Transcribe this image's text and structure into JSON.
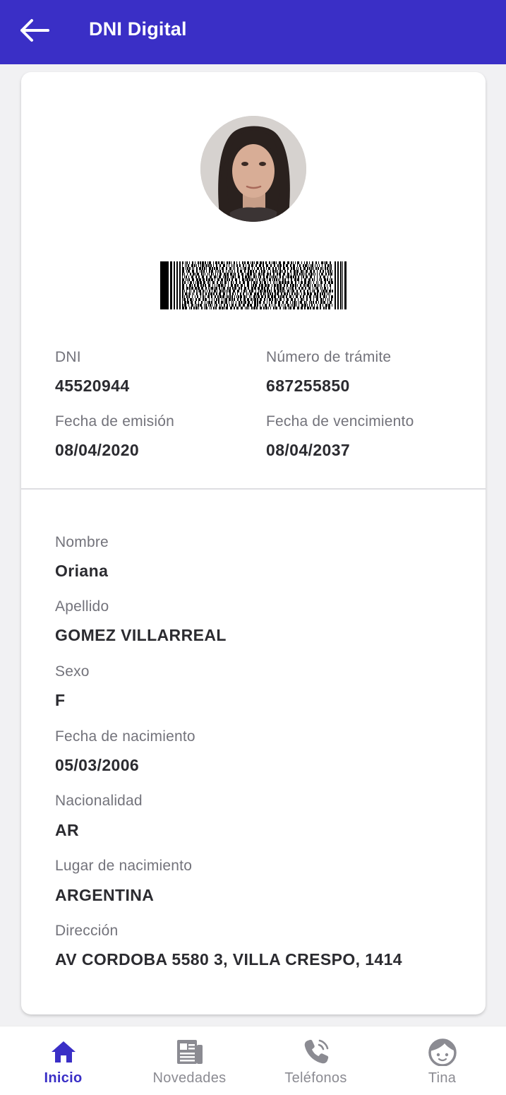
{
  "appbar": {
    "title": "DNI Digital",
    "back_icon": "arrow-left-icon",
    "color": "#3a2fc6"
  },
  "card": {
    "photo": "profile-photo",
    "barcode": "pdf417-barcode",
    "summary": [
      {
        "label": "DNI",
        "value": "45520944"
      },
      {
        "label": "Número de trámite",
        "value": "687255850"
      },
      {
        "label": "Fecha de emisión",
        "value": "08/04/2020"
      },
      {
        "label": "Fecha de vencimiento",
        "value": "08/04/2037"
      }
    ],
    "details": [
      {
        "label": "Nombre",
        "value": "Oriana"
      },
      {
        "label": "Apellido",
        "value": "GOMEZ VILLARREAL"
      },
      {
        "label": "Sexo",
        "value": "F"
      },
      {
        "label": "Fecha de nacimiento",
        "value": "05/03/2006"
      },
      {
        "label": "Nacionalidad",
        "value": "AR"
      },
      {
        "label": "Lugar de nacimiento",
        "value": "ARGENTINA"
      },
      {
        "label": "Dirección",
        "value": "AV CORDOBA 5580 3, VILLA CRESPO, 1414"
      }
    ]
  },
  "bottom_nav": {
    "items": [
      {
        "label": "Inicio",
        "icon": "home-icon",
        "active": true
      },
      {
        "label": "Novedades",
        "icon": "newspaper-icon",
        "active": false
      },
      {
        "label": "Teléfonos",
        "icon": "phone-icon",
        "active": false
      },
      {
        "label": "Tina",
        "icon": "tina-face-icon",
        "active": false
      }
    ],
    "active_color": "#3a2fc6",
    "inactive_color": "#8b8b92"
  }
}
